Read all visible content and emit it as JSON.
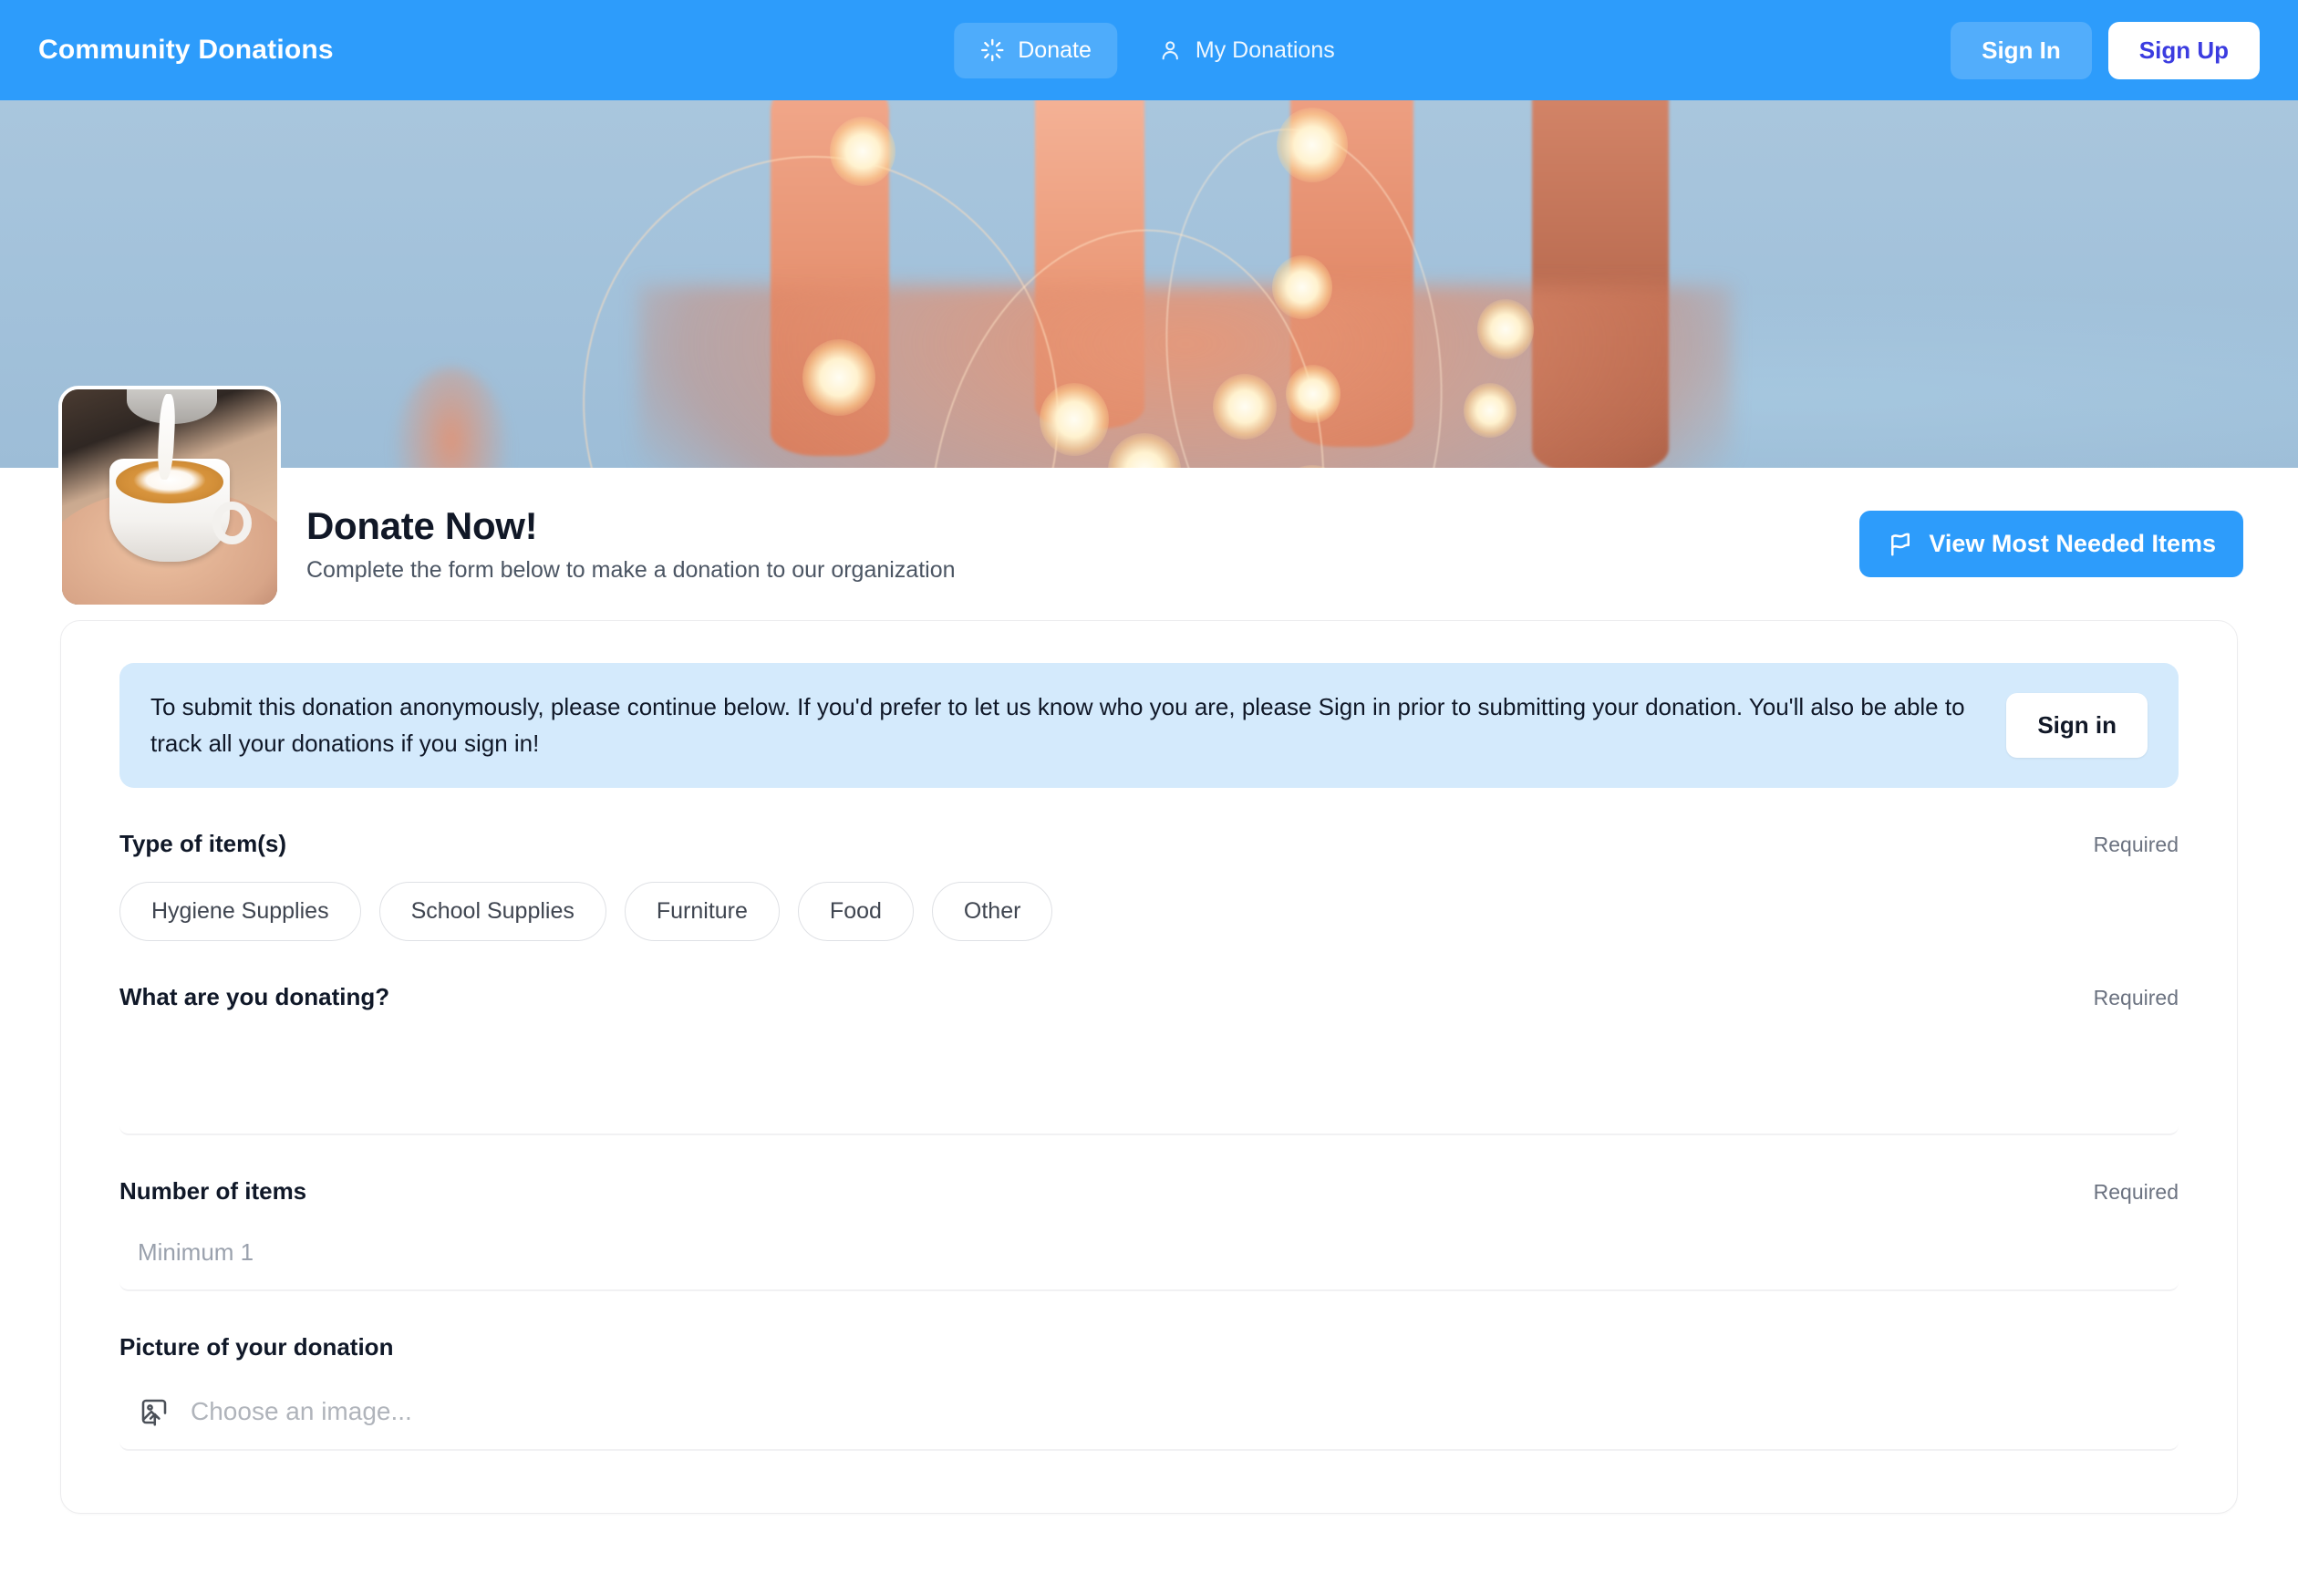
{
  "nav": {
    "brand": "Community Donations",
    "donate_label": "Donate",
    "donate_icon": "sparkle-spinner-icon",
    "my_donations_label": "My Donations",
    "my_donations_icon": "person-icon",
    "sign_in_label": "Sign In",
    "sign_up_label": "Sign Up",
    "bg_color": "#2d9cfb",
    "sign_up_text_color": "#3b3ce0"
  },
  "hero": {
    "alt": "hands holding warm fairy lights against a light blue background"
  },
  "header": {
    "avatar_alt": "latte coffee cup held in hands with milk being poured",
    "title": "Donate Now!",
    "subtitle": "Complete the form below to make a donation to our organization",
    "needed_items_label": "View Most Needed Items",
    "needed_items_icon": "flag-icon",
    "accent_color": "#2d9cfb"
  },
  "banner": {
    "text": "To submit this donation anonymously, please continue below. If you'd prefer to let us know who you are, please Sign in prior to submitting your donation. You'll also be able to track all your donations if you sign in!",
    "sign_in_label": "Sign in",
    "bg_color": "#d4eafc"
  },
  "form": {
    "required_label": "Required",
    "type_of_items": {
      "label": "Type of item(s)",
      "required": "Required",
      "options": [
        "Hygiene Supplies",
        "School Supplies",
        "Furniture",
        "Food",
        "Other"
      ]
    },
    "what_donating": {
      "label": "What are you donating?",
      "required": "Required",
      "value": "",
      "placeholder": ""
    },
    "number_of_items": {
      "label": "Number of items",
      "required": "Required",
      "value": "",
      "placeholder": "Minimum 1"
    },
    "picture": {
      "label": "Picture of your donation",
      "placeholder": "Choose an image...",
      "icon": "image-upload-icon"
    }
  }
}
